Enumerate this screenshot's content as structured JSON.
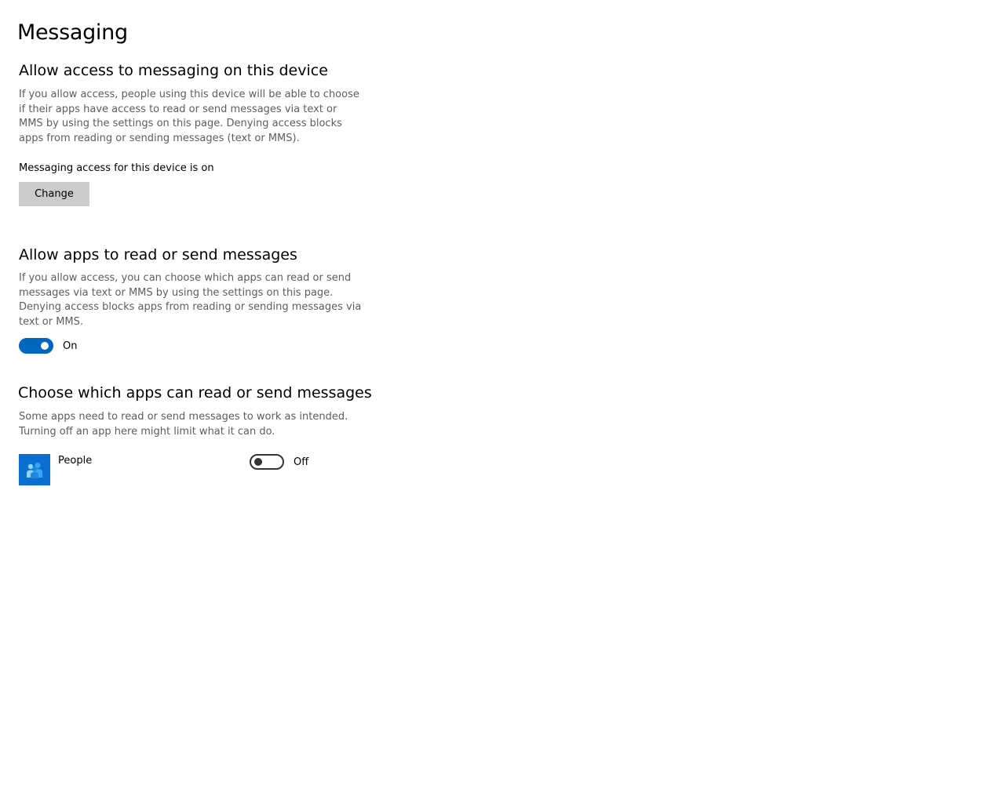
{
  "page": {
    "title": "Messaging"
  },
  "device_access": {
    "heading": "Allow access to messaging on this device",
    "description": "If you allow access, people using this device will be able to choose if their apps have access to read or send messages via text or MMS by using the settings on this page. Denying access blocks apps from reading or sending messages (text or MMS).",
    "status": "Messaging access for this device is on",
    "change_label": "Change"
  },
  "app_access": {
    "heading": "Allow apps to read or send messages",
    "description": "If you allow access, you can choose which apps can read or send messages via text or MMS by using the settings on this page. Denying access blocks apps from reading or sending messages via text or MMS.",
    "toggle_state": true,
    "toggle_label": "On"
  },
  "app_list": {
    "heading": "Choose which apps can read or send messages",
    "description": "Some apps need to read or send messages to work as intended. Turning off an app here might limit what it can do.",
    "apps": [
      {
        "name": "People",
        "icon": "people-icon",
        "toggle_state": false,
        "toggle_label": "Off"
      }
    ]
  },
  "colors": {
    "accent": "#0067c0",
    "button_bg": "#cccccc",
    "description_text": "#5d5d5d",
    "app_icon_bg": "#0a6fd0"
  }
}
